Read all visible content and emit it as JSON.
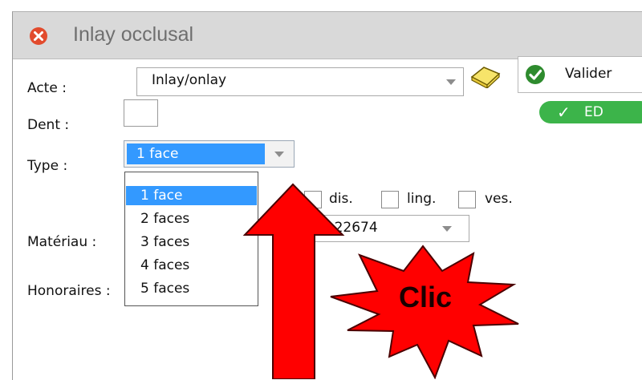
{
  "window": {
    "title": "Inlay occlusal",
    "close_icon": "close-circle-icon",
    "accent": "#e24b2d"
  },
  "form": {
    "acte": {
      "label": "Acte :",
      "value": "Inlay/onlay"
    },
    "dent": {
      "label": "Dent :",
      "value": ""
    },
    "type": {
      "label": "Type :",
      "value": "1 face",
      "options": [
        "1 face",
        "2 faces",
        "3 faces",
        "4 faces",
        "5 faces"
      ],
      "selected_index": 0
    },
    "faces": [
      {
        "label": "dis.",
        "checked": false
      },
      {
        "label": "ling.",
        "checked": false
      },
      {
        "label": "ves.",
        "checked": false
      }
    ],
    "materiau": {
      "label": "Matériau :",
      "value": "ISO 22674"
    },
    "honoraires": {
      "label": "Honoraires :"
    }
  },
  "actions": {
    "valider_label": "Valider",
    "ed_label": "ED",
    "ed_color": "#3cb44a",
    "book_icon": "book-icon"
  },
  "annotation": {
    "text": "Clic",
    "arrow_color": "#ff0000",
    "burst_color": "#ff0000"
  }
}
